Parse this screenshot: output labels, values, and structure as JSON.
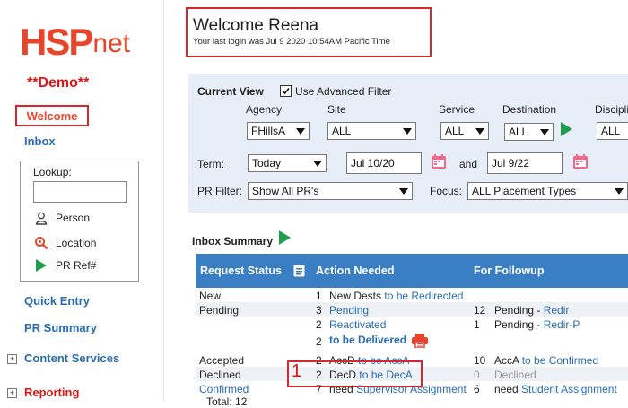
{
  "sidebar": {
    "logo_hsp": "HSP",
    "logo_net": "net",
    "demo": "**Demo**",
    "welcome": "Welcome",
    "inbox": "Inbox",
    "lookup": {
      "label": "Lookup:",
      "input_value": "",
      "items": [
        {
          "label": "Person",
          "icon": "person-icon"
        },
        {
          "label": "Location",
          "icon": "location-search-icon"
        },
        {
          "label": "PR Ref#",
          "icon": "play-icon"
        }
      ]
    },
    "quick_entry": "Quick Entry",
    "pr_summary": "PR Summary",
    "content_services": "Content Services",
    "reporting": "Reporting",
    "expand_symbol": "⊞"
  },
  "header": {
    "title": "Welcome Reena",
    "last_login": "Your last login was Jul 9 2020 10:54AM Pacific Time"
  },
  "filter": {
    "current_view": "Current View",
    "advanced_filter": "Use Advanced Filter",
    "advanced_checked": true,
    "agency_label": "Agency",
    "agency_value": "FHillsA",
    "site_label": "Site",
    "site_value": "ALL",
    "service_label": "Service",
    "service_value": "ALL",
    "destination_label": "Destination",
    "destination_value": "ALL",
    "discipline_label": "Discipli",
    "discipline_value": "ALL",
    "term_label": "Term:",
    "term_value": "Today",
    "date_from": "Jul 10/20",
    "and_label": "and",
    "date_to": "Jul 9/22",
    "pr_filter_label": "PR Filter:",
    "pr_filter_value": "Show All PR's",
    "focus_label": "Focus:",
    "focus_value": "ALL Placement Types"
  },
  "inbox": {
    "title": "Inbox Summary",
    "columns": [
      "Request Status",
      "Action Needed",
      "For Followup"
    ],
    "rows": {
      "new": {
        "status": "New",
        "a_num": "1",
        "a_text": "New Dests",
        "a_link": "to be Redirected"
      },
      "pending1": {
        "status": "Pending",
        "a_num": "3",
        "a_link": "Pending",
        "f_num": "12",
        "f_text": "Pending - ",
        "f_link": "Redir"
      },
      "pending2": {
        "a_num": "2",
        "a_link": "Reactivated",
        "f_num": "1",
        "f_text": "Pending - ",
        "f_link": "Redir-P"
      },
      "pending3": {
        "a_num": "2",
        "a_link": "to be Delivered"
      },
      "accepted": {
        "status": "Accepted",
        "a_num": "2",
        "a_text": "AccD",
        "a_link": "to be AccA",
        "f_num": "10",
        "f_text": "AccA",
        "f_link": "to be Confirmed"
      },
      "declined": {
        "status": "Declined",
        "a_num": "2",
        "a_text": "DecD",
        "a_link": "to be DecA",
        "f_num": "0",
        "f_text": "Declined"
      },
      "confirmed": {
        "status": "Confirmed",
        "a_num": "7",
        "a_text": "need",
        "a_link": "Supervisor Assignment",
        "f_num": "6",
        "f_text": "need",
        "f_link": "Student Assignment"
      },
      "total": "Total: 12"
    },
    "highlight_number": "1"
  },
  "colors": {
    "brand": "#e8452a",
    "link": "#2a6db5",
    "table_header": "#3a7ec4",
    "panel": "#e8eef8",
    "highlight": "#d9262c",
    "play": "#1f9e4b"
  }
}
